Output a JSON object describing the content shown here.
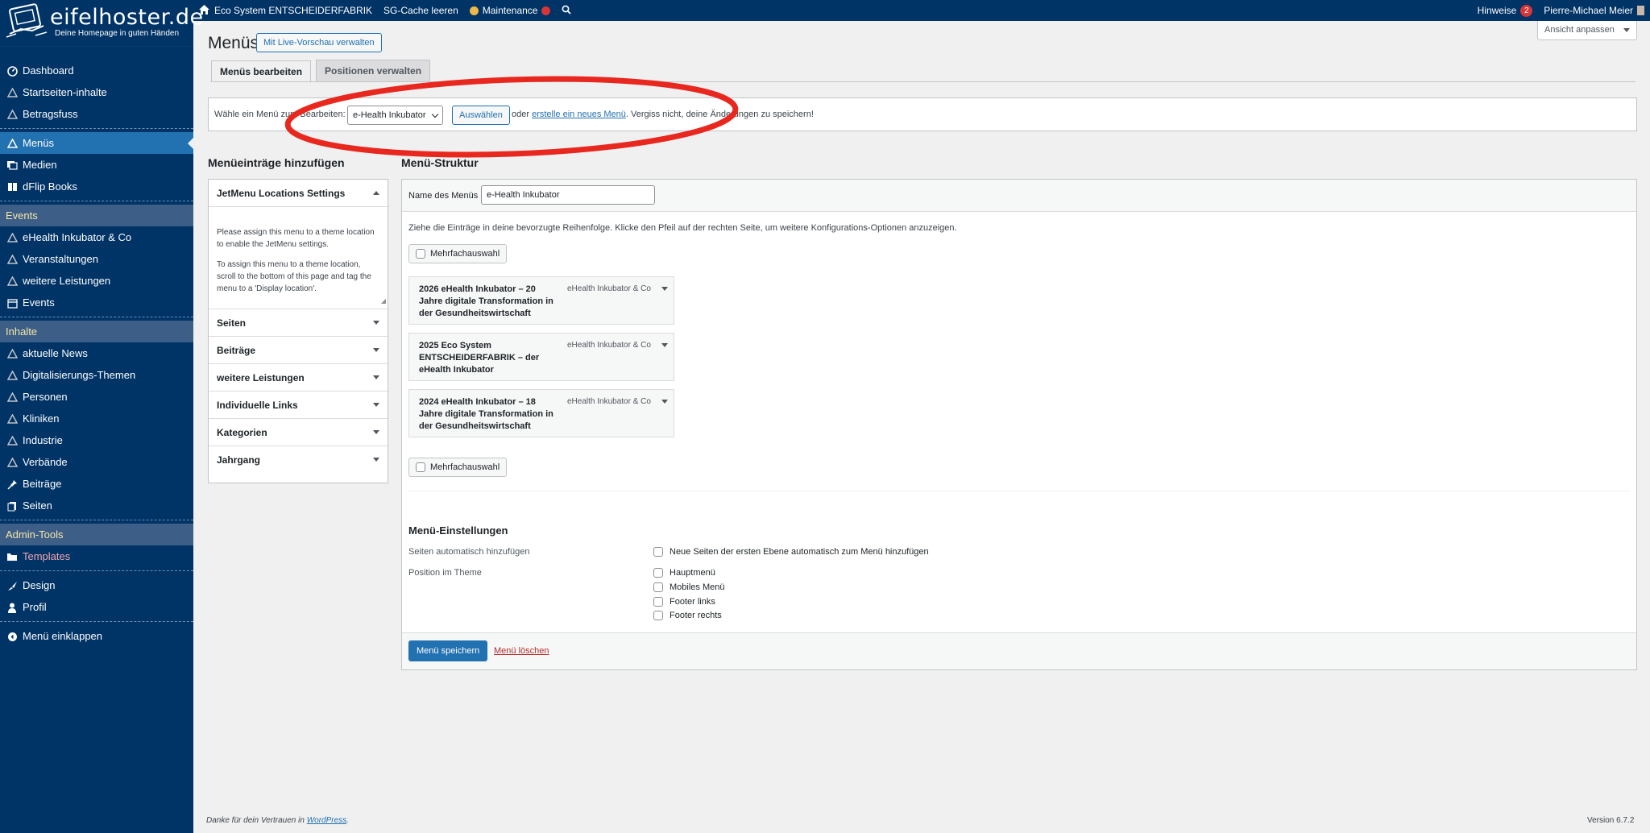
{
  "adminbar": {
    "site_name": "Eco System ENTSCHEIDERFABRIK",
    "cache": "SG-Cache leeren",
    "maintenance": "Maintenance",
    "hinweise": "Hinweise",
    "hinweise_count": "2",
    "user": "Pierre-Michael Meier"
  },
  "logo": {
    "text": "eifelhoster.de",
    "tagline": "Deine Homepage in guten Händen"
  },
  "sidebar": {
    "items": [
      {
        "label": "Dashboard",
        "icon": "dashboard-icon"
      },
      {
        "label": "Startseiten-inhalte",
        "icon": "triangle-icon"
      },
      {
        "label": "Betragsfuss",
        "icon": "triangle-icon"
      },
      {
        "label": "Menüs",
        "icon": "triangle-icon"
      },
      {
        "label": "Medien",
        "icon": "media-icon"
      },
      {
        "label": "dFlip Books",
        "icon": "book-icon"
      },
      {
        "label": "eHealth Inkubator & Co",
        "icon": "triangle-icon"
      },
      {
        "label": "Veranstaltungen",
        "icon": "triangle-icon"
      },
      {
        "label": "weitere Leistungen",
        "icon": "triangle-icon"
      },
      {
        "label": "Events",
        "icon": "calendar-icon"
      },
      {
        "label": "aktuelle News",
        "icon": "triangle-icon"
      },
      {
        "label": "Digitalisierungs-Themen",
        "icon": "triangle-icon"
      },
      {
        "label": "Personen",
        "icon": "triangle-icon"
      },
      {
        "label": "Kliniken",
        "icon": "triangle-icon"
      },
      {
        "label": "Industrie",
        "icon": "triangle-icon"
      },
      {
        "label": "Verbände",
        "icon": "triangle-icon"
      },
      {
        "label": "Beiträge",
        "icon": "pin-icon"
      },
      {
        "label": "Seiten",
        "icon": "pages-icon"
      },
      {
        "label": "Templates",
        "icon": "folder-icon"
      },
      {
        "label": "Design",
        "icon": "brush-icon"
      },
      {
        "label": "Profil",
        "icon": "user-icon"
      },
      {
        "label": "Menü einklappen",
        "icon": "collapse-icon"
      }
    ],
    "groups": {
      "events": "Events",
      "inhalte": "Inhalte",
      "admin": "Admin-Tools"
    }
  },
  "page": {
    "title": "Menüs",
    "live_preview": "Mit Live-Vorschau verwalten",
    "screen_options": "Ansicht anpassen",
    "tabs": [
      "Menüs bearbeiten",
      "Positionen verwalten"
    ],
    "select_label": "Wähle ein Menü zum Bearbeiten:",
    "selected_menu": "e-Health Inkubator",
    "select_button": "Auswählen",
    "or_text": "oder",
    "create_link": "erstelle ein neues Menü",
    "reminder": ". Vergiss nicht, deine Änderungen zu speichern!"
  },
  "left_panel": {
    "heading": "Menüeinträge hinzufügen",
    "jet_title": "JetMenu Locations Settings",
    "jet_text1": "Please assign this menu to a theme location to enable the JetMenu settings.",
    "jet_text2": "To assign this menu to a theme location, scroll to the bottom of this page and tag the menu to a 'Display location'.",
    "sections": [
      "Seiten",
      "Beiträge",
      "weitere Leistungen",
      "Individuelle Links",
      "Kategorien",
      "Jahrgang"
    ]
  },
  "structure": {
    "heading": "Menü-Struktur",
    "name_label": "Name des Menüs",
    "name_value": "e-Health Inkubator",
    "instructions": "Ziehe die Einträge in deine bevorzugte Reihenfolge. Klicke den Pfeil auf der rechten Seite, um weitere Konfigurations-Optionen anzuzeigen.",
    "multi_select": "Mehrfachauswahl",
    "items": [
      {
        "title": "2026 eHealth Inkubator – 20 Jahre digitale Transformation in der Gesundheitswirtschaft",
        "type": "eHealth Inkubator & Co"
      },
      {
        "title": "2025 Eco System ENTSCHEIDERFABRIK – der eHealth Inkubator",
        "type": "eHealth Inkubator & Co"
      },
      {
        "title": "2024 eHealth Inkubator – 18 Jahre digitale Transformation in der Gesundheitswirtschaft",
        "type": "eHealth Inkubator & Co"
      }
    ]
  },
  "settings": {
    "heading": "Menü-Einstellungen",
    "auto_label": "Seiten automatisch hinzufügen",
    "auto_option": "Neue Seiten der ersten Ebene automatisch zum Menü hinzufügen",
    "position_label": "Position im Theme",
    "positions": [
      "Hauptmenü",
      "Mobiles Menü",
      "Footer links",
      "Footer rechts"
    ],
    "save": "Menü speichern",
    "delete": "Menü löschen"
  },
  "footer": {
    "thanks": "Danke für dein Vertrauen in",
    "wp": "WordPress",
    "dot": ".",
    "version": "Version 6.7.2"
  },
  "colors": {
    "sidebar": "#003366",
    "accent": "#2271b1",
    "highlight_ellipse": "#e8281e"
  }
}
